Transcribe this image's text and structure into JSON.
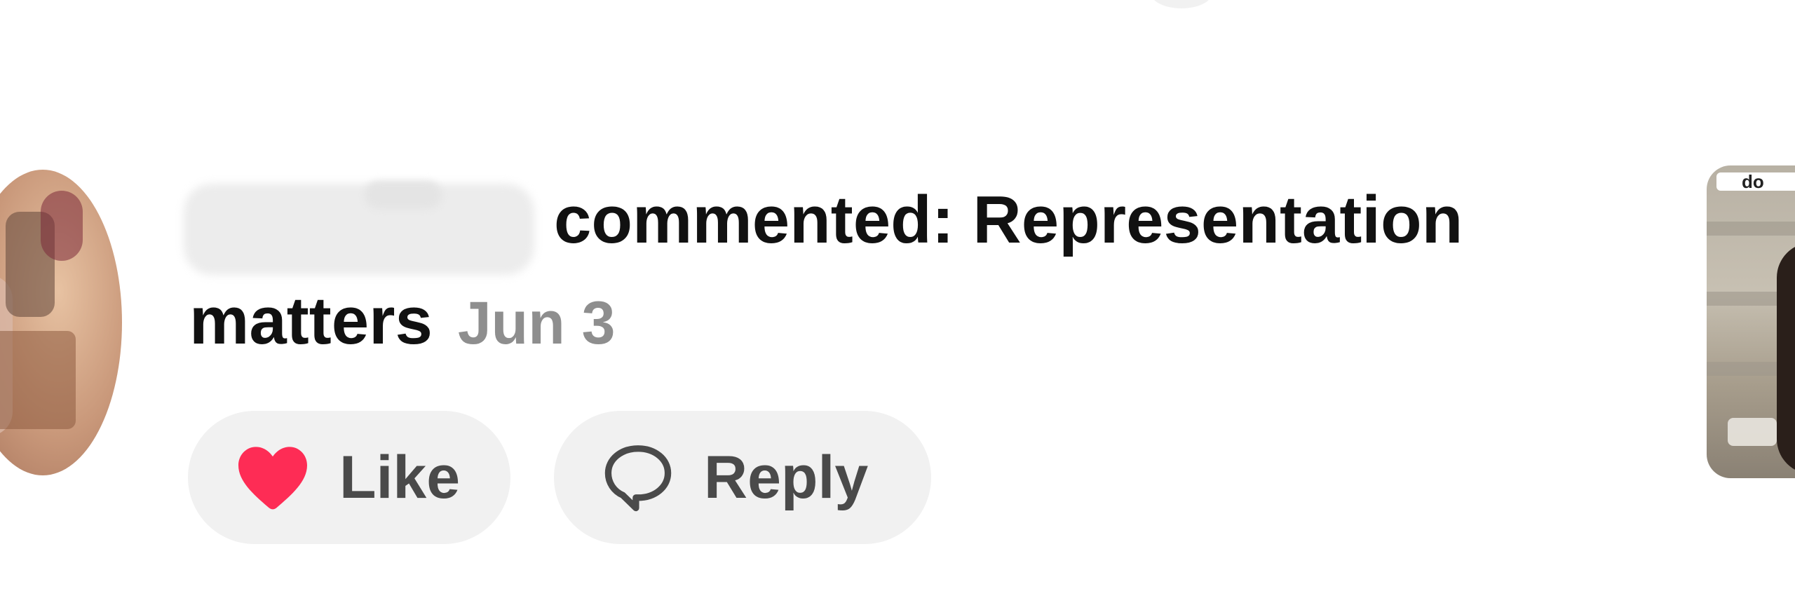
{
  "notification": {
    "action_text": "commented: Representation",
    "comment_continued": "matters",
    "date": "Jun 3"
  },
  "actions": {
    "like_label": "Like",
    "reply_label": "Reply"
  },
  "thumbnail": {
    "overlay_text": "do"
  },
  "icons": {
    "like": "heart-icon",
    "reply": "speech-bubble-icon"
  },
  "colors": {
    "like_heart": "#fe2c55",
    "pill_background": "#f1f1f1",
    "date_text": "#8e8e8e"
  }
}
